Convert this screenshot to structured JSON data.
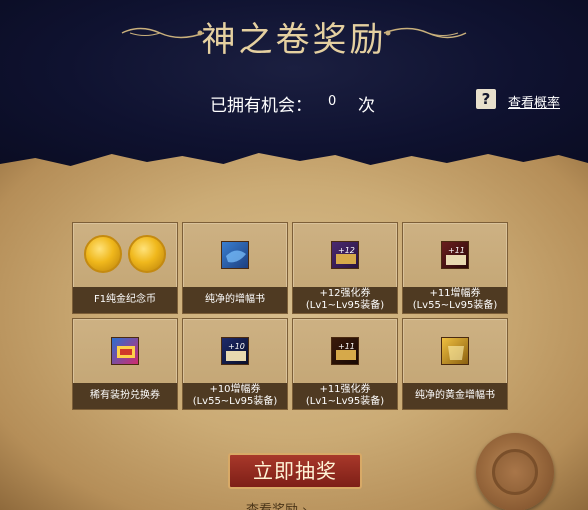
{
  "header": {
    "title": "神之卷奖励",
    "chance_label": "已拥有机会：",
    "chance_count": "0",
    "chance_unit": "次",
    "help_icon": "?",
    "probability_link": "查看概率"
  },
  "rewards": [
    {
      "label": "F1纯金纪念币",
      "icon": "gold-coin-icon"
    },
    {
      "label": "纯净的增幅书",
      "icon": "blue-book-icon"
    },
    {
      "label": "+12强化券 (Lv1~Lv95装备)",
      "icon": "enhance-ticket-12-icon"
    },
    {
      "label": "+11增幅券 (Lv55~Lv95装备)",
      "icon": "amplify-ticket-11-icon"
    },
    {
      "label": "稀有装扮兑换券",
      "icon": "rare-costume-ticket-icon"
    },
    {
      "label": "+10增幅券 (Lv55~Lv95装备)",
      "icon": "amplify-ticket-10-icon"
    },
    {
      "label": "+11强化券 (Lv1~Lv95装备)",
      "icon": "enhance-ticket-11-icon"
    },
    {
      "label": "纯净的黄金增幅书",
      "icon": "gold-book-icon"
    }
  ],
  "actions": {
    "draw_button": "立即抽奖",
    "view_rewards": "查看奖励 ›"
  },
  "colors": {
    "header_bg": "#0f1230",
    "title_gold": "#e5d0a0",
    "button_red": "#8e2a1f",
    "caption_brown": "#4f3a22"
  }
}
